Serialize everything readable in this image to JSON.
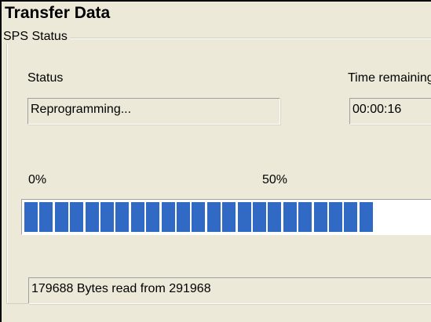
{
  "window": {
    "title": "Transfer Data"
  },
  "group": {
    "legend": "SPS Status",
    "status_label": "Status",
    "status_value": "Reprogramming...",
    "time_label": "Time remaining",
    "time_value": "00:00:16",
    "scale_start": "0%",
    "scale_mid": "50%",
    "progress_fraction": 0.6154,
    "progress_color": "#316ac5",
    "bytes_text": "179688 Bytes read from 291968"
  }
}
